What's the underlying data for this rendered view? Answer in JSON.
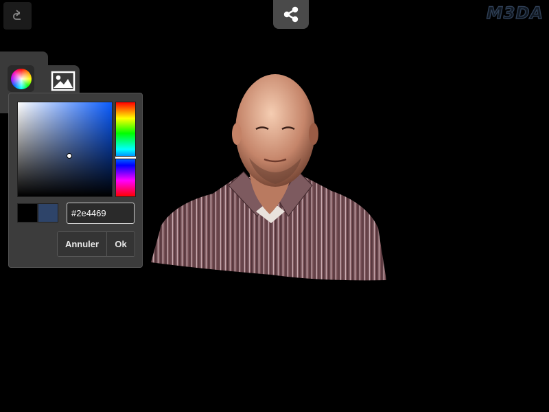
{
  "toolbar": {
    "undo_icon": "undo-icon",
    "share_icon": "share-icon",
    "logo_text": "M3DA"
  },
  "tabs": {
    "color_tab_icon": "color-wheel-icon",
    "image_tab_icon": "image-icon"
  },
  "color_picker": {
    "hex_value": "#2e4469",
    "previous_color": "#000000",
    "current_color": "#2e4469",
    "cancel_label": "Annuler",
    "ok_label": "Ok"
  },
  "viewer": {
    "model_icon": "3d-scan-bust"
  }
}
